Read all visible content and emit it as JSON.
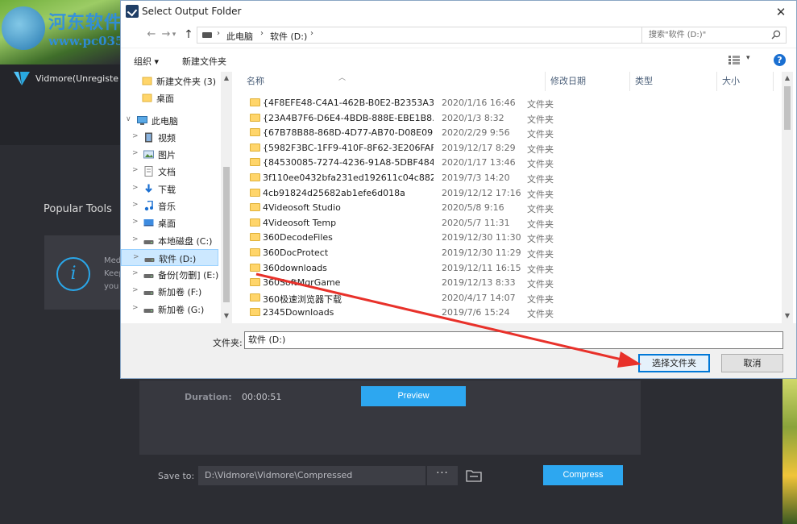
{
  "watermark": {
    "text": "河东软件园",
    "url": "www.pc0359.cn"
  },
  "app": {
    "title": "Vidmore(Unregistered)",
    "popular_tools": "Popular Tools",
    "tool_card_line1": "Med",
    "tool_card_line2": "Keep",
    "tool_card_line3": "you",
    "duration_label": "Duration:",
    "duration_value": "00:00:51",
    "preview_label": "Preview",
    "save_to_label": "Save to:",
    "save_to_path": "D:\\Vidmore\\Vidmore\\Compressed",
    "more_label": "···",
    "compress_label": "Compress",
    "accent_color": "#2da7f0"
  },
  "dialog": {
    "title": "Select Output Folder",
    "close_glyph": "✕",
    "address": {
      "crumbs": [
        "此电脑",
        "软件 (D:)"
      ]
    },
    "search_placeholder": "搜索\"软件 (D:)\"",
    "toolbar": {
      "organize": "组织 ▾",
      "new_folder": "新建文件夹"
    },
    "help_glyph": "?",
    "nav_tree": [
      {
        "label": "新建文件夹 (3)",
        "icon": "folder-icon"
      },
      {
        "label": "桌面",
        "icon": "folder-icon"
      },
      {
        "label": "此电脑",
        "icon": "computer-icon"
      },
      {
        "label": "视频",
        "icon": "video-icon"
      },
      {
        "label": "图片",
        "icon": "pictures-icon"
      },
      {
        "label": "文档",
        "icon": "documents-icon"
      },
      {
        "label": "下载",
        "icon": "download-icon"
      },
      {
        "label": "音乐",
        "icon": "music-icon"
      },
      {
        "label": "桌面",
        "icon": "desktop-icon"
      },
      {
        "label": "本地磁盘 (C:)",
        "icon": "drive-icon"
      },
      {
        "label": "软件 (D:)",
        "icon": "drive-icon",
        "selected": true
      },
      {
        "label": "备份[勿删] (E:)",
        "icon": "drive-icon"
      },
      {
        "label": "新加卷 (F:)",
        "icon": "drive-icon"
      },
      {
        "label": "新加卷 (G:)",
        "icon": "drive-icon"
      }
    ],
    "columns": {
      "name": "名称",
      "date": "修改日期",
      "type": "类型",
      "size": "大小"
    },
    "files": [
      {
        "name": "{4F8EFE48-C4A1-462B-B0E2-B2353A3...",
        "date": "2020/1/16 16:46",
        "type": "文件夹"
      },
      {
        "name": "{23A4B7F6-D6E4-4BDB-888E-EBE1B8...",
        "date": "2020/1/3 8:32",
        "type": "文件夹"
      },
      {
        "name": "{67B78B88-868D-4D77-AB70-D08E09...",
        "date": "2020/2/29 9:56",
        "type": "文件夹"
      },
      {
        "name": "{5982F3BC-1FF9-410F-8F62-3E206FAF...",
        "date": "2019/12/17 8:29",
        "type": "文件夹"
      },
      {
        "name": "{84530085-7274-4236-91A8-5DBF484...",
        "date": "2020/1/17 13:46",
        "type": "文件夹"
      },
      {
        "name": "3f110ee0432bfa231ed192611c04c882",
        "date": "2019/7/3 14:20",
        "type": "文件夹"
      },
      {
        "name": "4cb91824d25682ab1efe6d018a",
        "date": "2019/12/12 17:16",
        "type": "文件夹"
      },
      {
        "name": "4Videosoft Studio",
        "date": "2020/5/8 9:16",
        "type": "文件夹"
      },
      {
        "name": "4Videosoft Temp",
        "date": "2020/5/7 11:31",
        "type": "文件夹"
      },
      {
        "name": "360DecodeFiles",
        "date": "2019/12/30 11:30",
        "type": "文件夹"
      },
      {
        "name": "360DocProtect",
        "date": "2019/12/30 11:29",
        "type": "文件夹"
      },
      {
        "name": "360downloads",
        "date": "2019/12/11 16:15",
        "type": "文件夹"
      },
      {
        "name": "360SoftMgrGame",
        "date": "2019/12/13 8:33",
        "type": "文件夹"
      },
      {
        "name": "360极速浏览器下载",
        "date": "2020/4/17 14:07",
        "type": "文件夹"
      },
      {
        "name": "2345Downloads",
        "date": "2019/7/6 15:24",
        "type": "文件夹"
      }
    ],
    "folder_label": "文件夹:",
    "folder_value": "软件 (D:)",
    "select_button": "选择文件夹",
    "cancel_button": "取消",
    "annotation_color": "#e8312a"
  }
}
